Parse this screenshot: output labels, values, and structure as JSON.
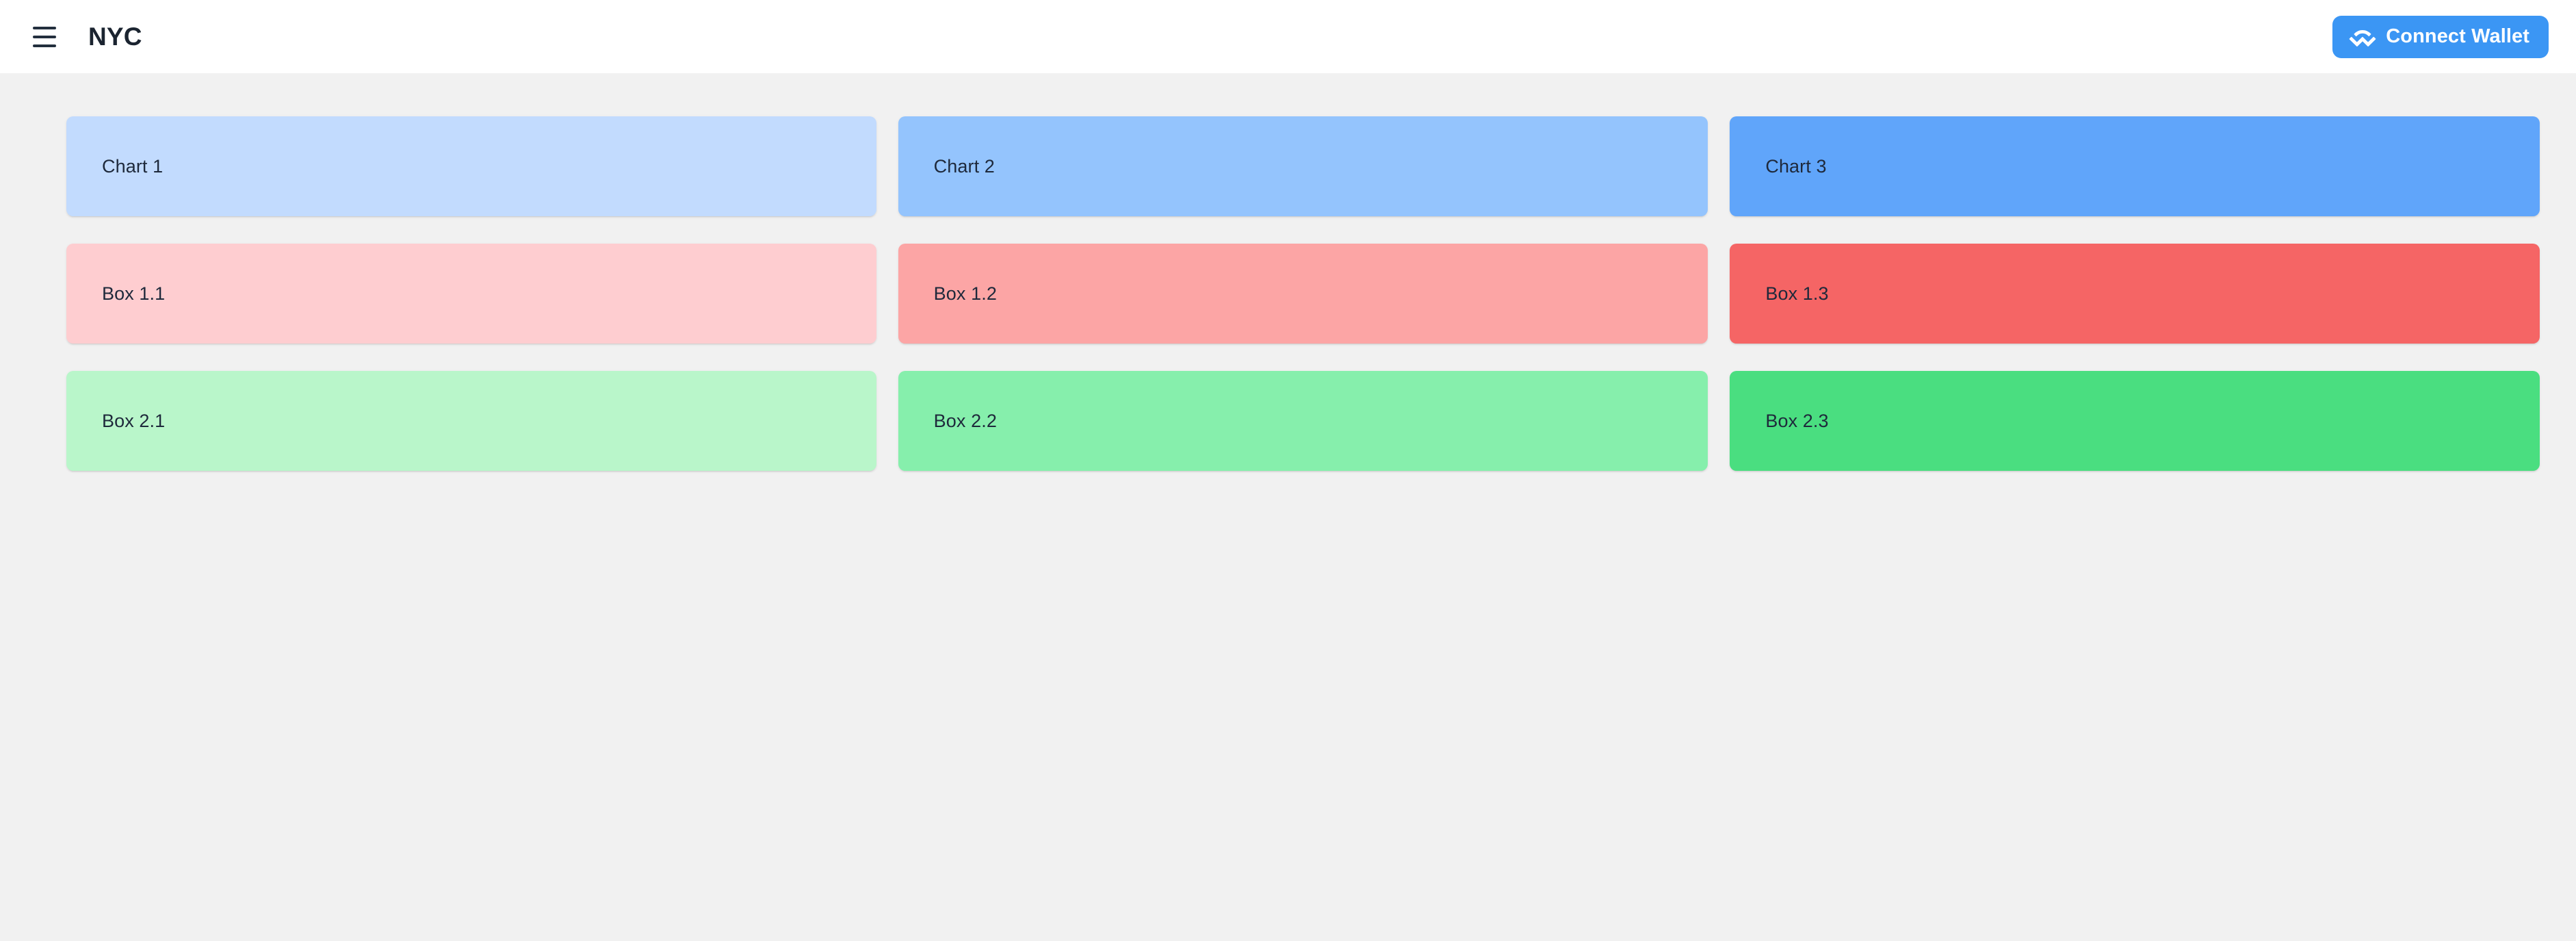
{
  "header": {
    "menu_icon": "hamburger-menu-icon",
    "title": "NYC",
    "connect_wallet": {
      "label": "Connect Wallet",
      "icon": "walletconnect-icon",
      "background_color": "#3b96f4",
      "text_color": "#ffffff"
    },
    "background_color": "#ffffff"
  },
  "page": {
    "background_color": "#f1f1f1",
    "text_color": "#1e293b"
  },
  "rows": [
    {
      "name": "charts-row",
      "cards": [
        {
          "label": "Chart 1",
          "color": "#c2dbfe"
        },
        {
          "label": "Chart 2",
          "color": "#94c4fd"
        },
        {
          "label": "Chart 3",
          "color": "#60a5fa"
        }
      ]
    },
    {
      "name": "boxes-row-1",
      "cards": [
        {
          "label": "Box 1.1",
          "color": "#fecdd0"
        },
        {
          "label": "Box 1.2",
          "color": "#fca5a5"
        },
        {
          "label": "Box 1.3",
          "color": "#f56565"
        }
      ]
    },
    {
      "name": "boxes-row-2",
      "cards": [
        {
          "label": "Box 2.1",
          "color": "#b9f6ca"
        },
        {
          "label": "Box 2.2",
          "color": "#86efac"
        },
        {
          "label": "Box 2.3",
          "color": "#4ade80"
        }
      ]
    }
  ]
}
